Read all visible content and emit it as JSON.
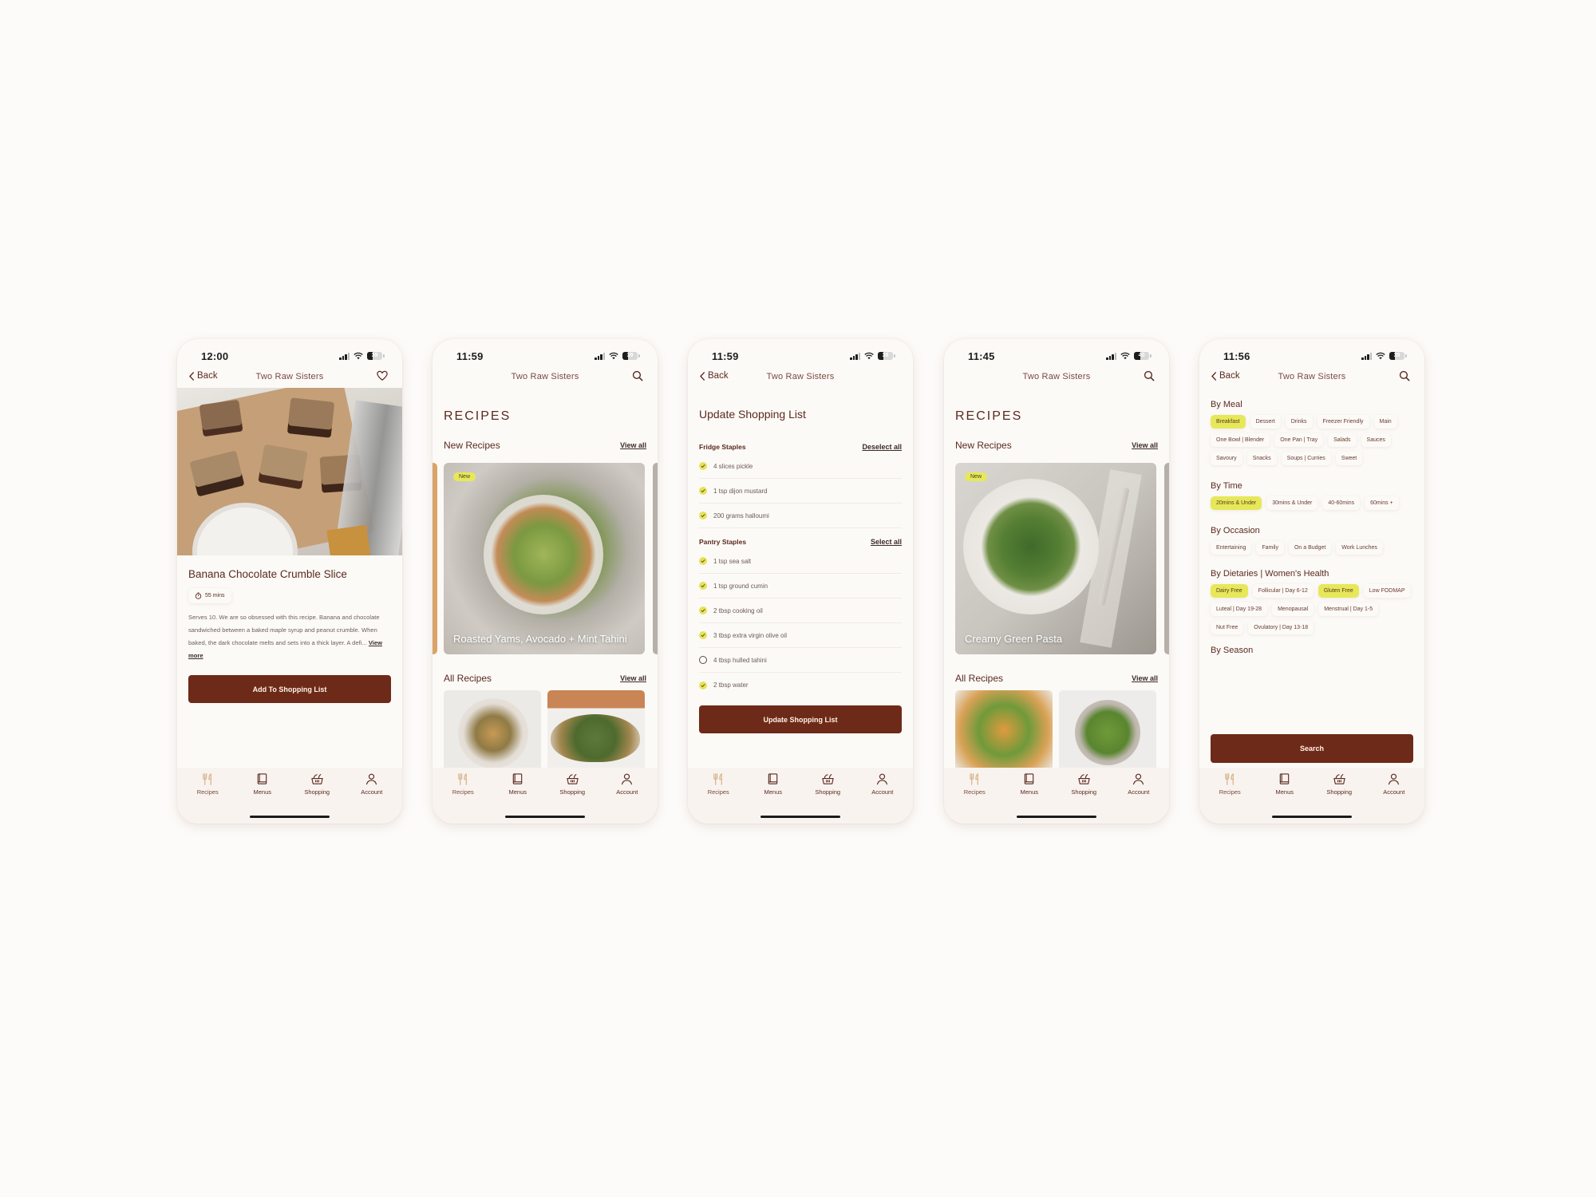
{
  "app": {
    "name": "Two Raw Sisters",
    "colors": {
      "primary": "#6e2a18",
      "accent_highlight": "#e6e85a",
      "background": "#fcfaf7",
      "text": "#5a2a1f"
    }
  },
  "tabbar": {
    "items": [
      {
        "label": "Recipes",
        "icon": "fork-knife-icon",
        "active": true
      },
      {
        "label": "Menus",
        "icon": "book-icon",
        "active": false
      },
      {
        "label": "Shopping",
        "icon": "basket-icon",
        "active": false
      },
      {
        "label": "Account",
        "icon": "person-icon",
        "active": false
      }
    ]
  },
  "screens": [
    {
      "id": "recipe-detail",
      "status": {
        "time": "12:00",
        "battery": "39"
      },
      "nav": {
        "back_label": "Back",
        "title": "Two Raw Sisters",
        "right_icon": "heart-icon"
      },
      "recipe": {
        "title": "Banana Chocolate Crumble Slice",
        "duration": "55 mins",
        "description": "Serves 10. We are so obsessed with this recipe. Banana and chocolate sandwiched between a baked maple syrup and peanut crumble. When baked, the dark chocolate melts and sets into a thick layer. A defi...",
        "view_more": "View more",
        "cta": "Add To Shopping List"
      }
    },
    {
      "id": "recipes-home-1",
      "status": {
        "time": "11:59",
        "battery": "39"
      },
      "nav": {
        "title": "Two Raw Sisters",
        "right_icon": "search-icon"
      },
      "heading": "RECIPES",
      "new_recipes": {
        "title": "New Recipes",
        "view_all": "View all",
        "badge": "New",
        "featured": "Roasted Yams, Avocado + Mint Tahini"
      },
      "all_recipes": {
        "title": "All Recipes",
        "view_all": "View all"
      }
    },
    {
      "id": "shopping-update",
      "status": {
        "time": "11:59",
        "battery": "39"
      },
      "nav": {
        "back_label": "Back",
        "title": "Two Raw Sisters"
      },
      "heading": "Update Shopping List",
      "groups": [
        {
          "title": "Fridge Staples",
          "action": "Deselect all",
          "items": [
            {
              "label": "4 slices pickle",
              "checked": true
            },
            {
              "label": "1 tsp dijon mustard",
              "checked": true
            },
            {
              "label": "200 grams halloumi",
              "checked": true
            }
          ]
        },
        {
          "title": "Pantry Staples",
          "action": "Select all",
          "items": [
            {
              "label": "1 tsp sea salt",
              "checked": true
            },
            {
              "label": "1 tsp ground cumin",
              "checked": true
            },
            {
              "label": "2 tbsp cooking oil",
              "checked": true
            },
            {
              "label": "3 tbsp extra virgin olive oil",
              "checked": true
            },
            {
              "label": "4 tbsp hulled tahini",
              "checked": false
            },
            {
              "label": "2 tbsp water",
              "checked": true
            }
          ]
        }
      ],
      "cta": "Update Shopping List"
    },
    {
      "id": "recipes-home-2",
      "status": {
        "time": "11:45",
        "battery": "40"
      },
      "nav": {
        "title": "Two Raw Sisters",
        "right_icon": "search-icon"
      },
      "heading": "RECIPES",
      "new_recipes": {
        "title": "New Recipes",
        "view_all": "View all",
        "badge": "New",
        "featured": "Creamy Green Pasta"
      },
      "all_recipes": {
        "title": "All Recipes",
        "view_all": "View all"
      }
    },
    {
      "id": "recipe-filters",
      "status": {
        "time": "11:56",
        "battery": "39"
      },
      "nav": {
        "back_label": "Back",
        "title": "Two Raw Sisters",
        "right_icon": "search-icon"
      },
      "filters": [
        {
          "title": "By Meal",
          "chips": [
            {
              "label": "Breakfast",
              "selected": true
            },
            {
              "label": "Dessert",
              "selected": false
            },
            {
              "label": "Drinks",
              "selected": false
            },
            {
              "label": "Freezer Friendly",
              "selected": false
            },
            {
              "label": "Main",
              "selected": false
            },
            {
              "label": "One Bowl | Blender",
              "selected": false
            },
            {
              "label": "One Pan | Tray",
              "selected": false
            },
            {
              "label": "Salads",
              "selected": false
            },
            {
              "label": "Sauces",
              "selected": false
            },
            {
              "label": "Savoury",
              "selected": false
            },
            {
              "label": "Snacks",
              "selected": false
            },
            {
              "label": "Soups | Curries",
              "selected": false
            },
            {
              "label": "Sweet",
              "selected": false
            }
          ]
        },
        {
          "title": "By Time",
          "chips": [
            {
              "label": "20mins & Under",
              "selected": true
            },
            {
              "label": "30mins & Under",
              "selected": false
            },
            {
              "label": "40-60mins",
              "selected": false
            },
            {
              "label": "60mins +",
              "selected": false
            }
          ]
        },
        {
          "title": "By Occasion",
          "chips": [
            {
              "label": "Entertaining",
              "selected": false
            },
            {
              "label": "Family",
              "selected": false
            },
            {
              "label": "On a Budget",
              "selected": false
            },
            {
              "label": "Work Lunches",
              "selected": false
            }
          ]
        },
        {
          "title": "By Dietaries | Women's Health",
          "chips": [
            {
              "label": "Dairy Free",
              "selected": true
            },
            {
              "label": "Follicular | Day 6-12",
              "selected": false
            },
            {
              "label": "Gluten Free",
              "selected": true
            },
            {
              "label": "Low FODMAP",
              "selected": false
            },
            {
              "label": "Luteal | Day 19-28",
              "selected": false
            },
            {
              "label": "Menopausal",
              "selected": false
            },
            {
              "label": "Menstrual | Day 1-5",
              "selected": false
            },
            {
              "label": "Nut Free",
              "selected": false
            },
            {
              "label": "Ovulatory | Day 13-18",
              "selected": false
            }
          ]
        },
        {
          "title": "By Season",
          "chips": []
        }
      ],
      "cta": "Search"
    }
  ]
}
